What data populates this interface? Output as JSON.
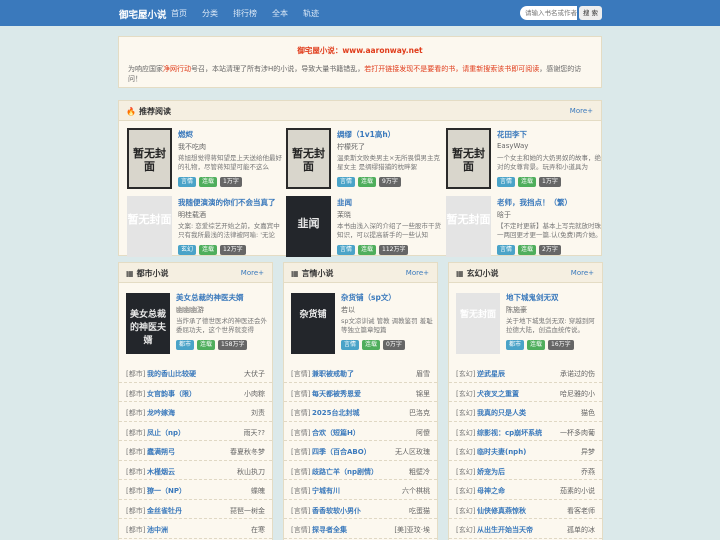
{
  "nav": {
    "brand": "御宅屋小说",
    "links": [
      "首页",
      "分类",
      "排行榜",
      "全本",
      "轨迹"
    ],
    "search_placeholder": "请输入书名或作者",
    "search_button": "搜 索"
  },
  "notice": {
    "title": "御宅屋小说：www.aaronway.net",
    "body_part1": "为响应国家",
    "body_red1": "净网行动",
    "body_part2": "号召，本站清理了所有涉H的小说，导致大量书籍错乱，",
    "body_red2": "若打开链接发现不是要看的书，请重新搜索该书即可阅读",
    "body_part3": "，感谢您的访问！"
  },
  "recommend": {
    "title": "推荐阅读",
    "more": "More+",
    "books": [
      {
        "name": "燃烬",
        "author": "我不吃肉",
        "desc": "蒋旭想觉得蒋知望是上天送给他最好的礼物，尽管蒋知望可能不这么",
        "tags": [
          "言情",
          "连载",
          "1万字"
        ],
        "cover": "暂无封面"
      },
      {
        "name": "绸缪（1v1高h）",
        "author": "柠檬死了",
        "desc": "温柔斯文败类男主×无所畏惧男主克星女主 是绸缪猎捕的枕畔絮",
        "tags": [
          "言情",
          "连载",
          "9万字"
        ],
        "cover": "暂无封面"
      },
      {
        "name": "花田李下",
        "author": "EasyWay",
        "desc": "一个女主和她的大奶男奴的故事，绝对的女尊背景。玩弄和小道具为",
        "tags": [
          "言情",
          "连载",
          "1万字"
        ],
        "cover": "暂无封面"
      },
      {
        "name": "我随便演演的你们不会当真了",
        "author": "明桂载酒",
        "desc": "文案: 恋爱综艺开始之前，女嘉宾中只有我所最浅的法律被阿喻: '无论",
        "tags": [
          "玄幻",
          "连载",
          "12万字"
        ],
        "cover": "暂无封面"
      },
      {
        "name": "韭闻",
        "author": "茉晓",
        "desc": "本书由浅入深的介绍了一些股市干货知识，可以提高新手的一些认知",
        "tags": [
          "言情",
          "连载",
          "112万字"
        ],
        "cover": "韭闻"
      },
      {
        "name": "老师，我挡点！（繁）",
        "author": "晗于",
        "desc": "【不定时更新】基本上写完就放时珠一两回更才更一篇.认(免费)两介她。",
        "tags": [
          "言情",
          "连载",
          "2万字"
        ],
        "cover": "暂无封面"
      }
    ]
  },
  "cols": [
    {
      "title": "都市小说",
      "more": "More+",
      "feature": {
        "name": "美女总裁的神医夫婿",
        "author": "幽幽幽游",
        "desc": "当炸承了德世医术的神医还会外委屈功夫，这个世界就变得",
        "tags": [
          "都市",
          "连载",
          "158万字"
        ],
        "cover": "美女总裁的神医夫婿"
      },
      "rows": [
        {
          "cat": "[都市]",
          "name": "我的香山比较硬",
          "author": "大伏子"
        },
        {
          "cat": "[都市]",
          "name": "女官韵事（限）",
          "author": "小肉粽"
        },
        {
          "cat": "[都市]",
          "name": "龙吟嫁海",
          "author": "刘责"
        },
        {
          "cat": "[都市]",
          "name": "凤止（np）",
          "author": "雨天??"
        },
        {
          "cat": "[都市]",
          "name": "蠢满朔弓",
          "author": "春夏秋冬梦"
        },
        {
          "cat": "[都市]",
          "name": "木槿烟云",
          "author": "秋山执刀"
        },
        {
          "cat": "[都市]",
          "name": "獠一（NP）",
          "author": "蝶魄"
        },
        {
          "cat": "[都市]",
          "name": "金丝雀牡丹",
          "author": "琵琶一树金"
        },
        {
          "cat": "[都市]",
          "name": "池中洲",
          "author": "在寒"
        }
      ]
    },
    {
      "title": "言情小说",
      "more": "More+",
      "feature": {
        "name": "杂货铺（sp文）",
        "author": "若以",
        "desc": "sp文凉训诫 管教 调教鉴罚 羞耻等独立篇章短篇",
        "tags": [
          "言情",
          "连载",
          "0万字"
        ],
        "cover": "杂货铺"
      },
      "rows": [
        {
          "cat": "[言情]",
          "name": "兼职被戒勒了",
          "author": "眉雪"
        },
        {
          "cat": "[言情]",
          "name": "每天都被秀恩爱",
          "author": "锦里"
        },
        {
          "cat": "[言情]",
          "name": "2025台北封城",
          "author": "巴洛克"
        },
        {
          "cat": "[言情]",
          "name": "合欢（短篇H）",
          "author": "阿傻"
        },
        {
          "cat": "[言情]",
          "name": "四季（百合ABO）",
          "author": "无人区玫瑰"
        },
        {
          "cat": "[言情]",
          "name": "歧路亡羊（np剧情）",
          "author": "粗壁冷"
        },
        {
          "cat": "[言情]",
          "name": "宁城有川",
          "author": "六个棋桃"
        },
        {
          "cat": "[言情]",
          "name": "香香软软小男仆",
          "author": "吃蛋猫"
        },
        {
          "cat": "[言情]",
          "name": "探寻者全集",
          "author": "[美]亚玟·埃"
        }
      ]
    },
    {
      "title": "玄幻小说",
      "more": "More+",
      "feature": {
        "name": "地下城鬼剑无双",
        "author": "陈施豪",
        "desc": "关于地下城鬼剑无双: 穿越到阿拉德大陆，创造血统传说。",
        "tags": [
          "都市",
          "连载",
          "16万字"
        ],
        "cover": "暂无封面"
      },
      "rows": [
        {
          "cat": "[玄幻]",
          "name": "逆武星辰",
          "author": "承诺过的伤"
        },
        {
          "cat": "[玄幻]",
          "name": "犬夜叉之重置",
          "author": "哈尼雅的小"
        },
        {
          "cat": "[玄幻]",
          "name": "我真的只是人类",
          "author": "猫色"
        },
        {
          "cat": "[玄幻]",
          "name": "综影视：cp崩坏系统",
          "author": "一杯多肉葡"
        },
        {
          "cat": "[玄幻]",
          "name": "临时夫妻(nph)",
          "author": "异梦"
        },
        {
          "cat": "[玄幻]",
          "name": "娇宠为后",
          "author": "乔燕"
        },
        {
          "cat": "[玄幻]",
          "name": "母神之命",
          "author": "茄素的小说"
        },
        {
          "cat": "[玄幻]",
          "name": "仙侠修真燕惊秋",
          "author": "看客老师"
        },
        {
          "cat": "[玄幻]",
          "name": "从出生开始当天帝",
          "author": "孤单的冰"
        }
      ]
    }
  ]
}
